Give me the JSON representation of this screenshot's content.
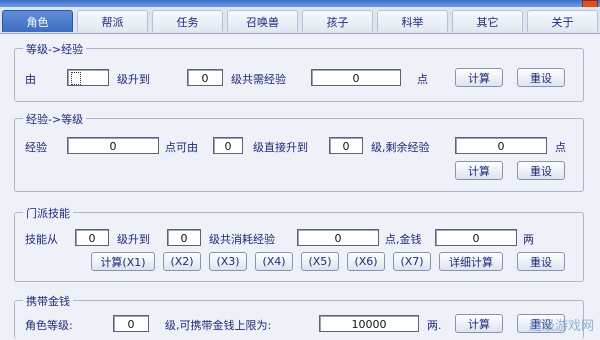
{
  "tabs": [
    "角色",
    "帮派",
    "任务",
    "召唤兽",
    "孩子",
    "科举",
    "其它",
    "关于"
  ],
  "group1": {
    "label": "等级->经验",
    "from_label": "由",
    "from_value": "",
    "to_label": "级升到",
    "to_value": "0",
    "need_label": "级共需经验",
    "need_value": "0",
    "unit": "点",
    "calc": "计算",
    "reset": "重设"
  },
  "group2": {
    "label": "经验->等级",
    "exp_label": "经验",
    "exp_value": "0",
    "from_label": "点可由",
    "from_value": "0",
    "direct_label": "级直接升到",
    "direct_value": "0",
    "remain_label": "级,剩余经验",
    "remain_value": "0",
    "unit": "点",
    "calc": "计算",
    "reset": "重设"
  },
  "group3": {
    "label": "门派技能",
    "skill_from_label": "技能从",
    "skill_from_value": "0",
    "to_label": "级升到",
    "to_value": "0",
    "cost_label": "级共消耗经验",
    "cost_value": "0",
    "money_label": "点,金钱",
    "money_value": "0",
    "money_unit": "两",
    "buttons": [
      "计算(X1)",
      "(X2)",
      "(X3)",
      "(X4)",
      "(X5)",
      "(X6)",
      "(X7)",
      "详细计算",
      "重设"
    ]
  },
  "group4": {
    "label": "携带金钱",
    "level_label": "角色等级:",
    "level_value": "0",
    "limit_label": "级,可携带金钱上限为:",
    "limit_value": "10000",
    "unit": "两.",
    "calc": "计算",
    "reset": "重设"
  },
  "watermark": "超级游戏网"
}
